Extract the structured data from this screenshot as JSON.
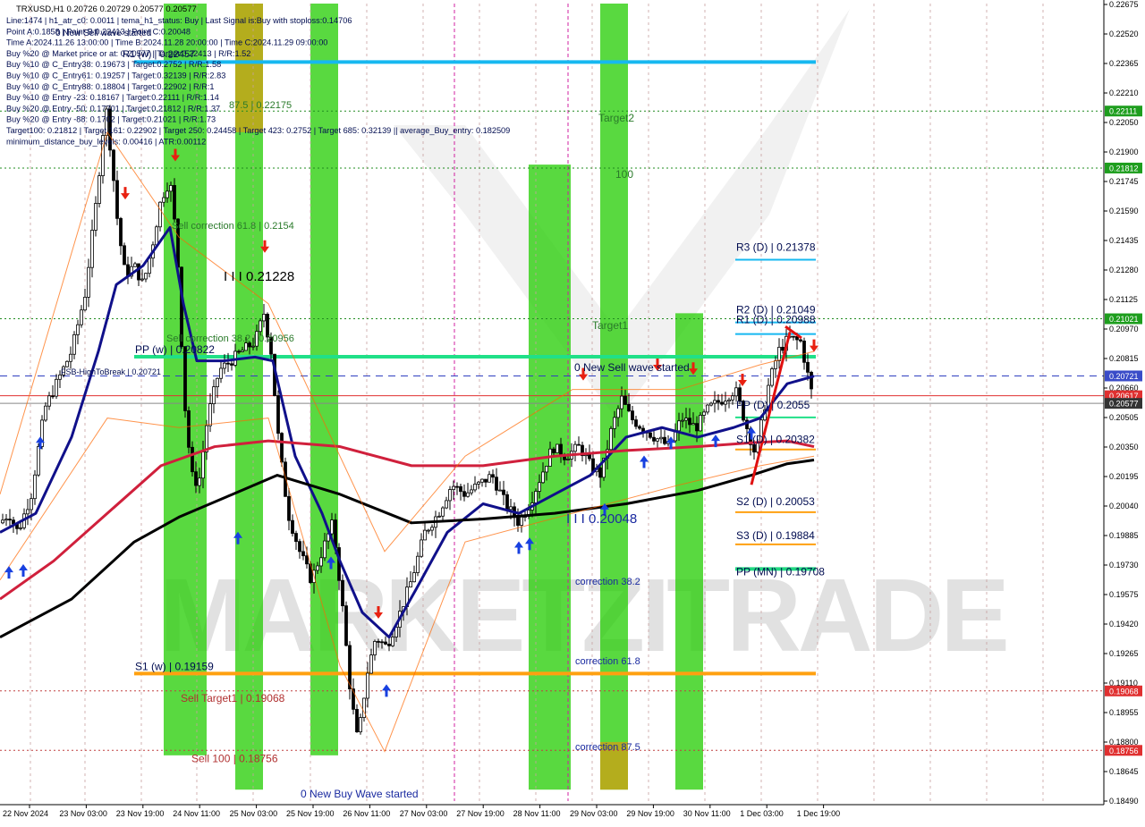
{
  "symbol_header": "TRXUSD,H1  0.20726 0.20729 0.20577 0.20577",
  "info_lines": [
    "Line:1474 | h1_atr_c0: 0.0011 | tema_h1_status: Buy | Last Signal is:Buy with stoploss:0.14706",
    "Point A:0.1858 | Point B:0.22413 | Point C:0.20048",
    "Time A:2024.11.26 13:00:00 | Time B:2024.11.28 20:00:00 | Time C:2024.11.29 09:00:00",
    "Buy %20 @ Market price or at: 0.20577 | Target:0.22413 | R/R:1.52",
    "Buy %10 @ C_Entry38: 0.19673 | Target:0.2752 | R/R:1.58",
    "Buy %10 @ C_Entry61: 0.19257 | Target:0.32139 | R/R:2.83",
    "Buy %10 @ C_Entry88: 0.18804 | Target:0.22902 | R/R:1",
    "Buy %10 @ Entry -23: 0.18167 | Target:0.22111 | R/R:1.14",
    "Buy %20 @ Entry -50: 0.17701 | Target:0.21812 | R/R:1.37",
    "Buy %20 @ Entry -88: 0.1702 | Target:0.21021 | R/R:1.73",
    "Target100: 0.21812 | Target 161: 0.22902 | Target 250: 0.24458 | Target 423: 0.2752 | Target 685: 0.32139 || average_Buy_entry: 0.182509",
    "minimum_distance_buy_levels: 0.00416 | ATR:0.00112"
  ],
  "watermark": "MARKETZITRADE",
  "price_axis": {
    "min": 0.1849,
    "max": 0.22675,
    "ticks": [
      "0.22675",
      "0.22520",
      "0.22365",
      "0.22210",
      "0.22050",
      "0.21900",
      "0.21745",
      "0.21590",
      "0.21435",
      "0.21280",
      "0.21125",
      "0.20970",
      "0.20815",
      "0.20660",
      "0.20505",
      "0.20350",
      "0.20195",
      "0.20040",
      "0.19885",
      "0.19730",
      "0.19575",
      "0.19420",
      "0.19265",
      "0.19110",
      "0.18955",
      "0.18800",
      "0.18645",
      "0.18490"
    ]
  },
  "time_axis": {
    "labels": [
      "22 Nov 2024",
      "23 Nov 03:00",
      "23 Nov 19:00",
      "24 Nov 11:00",
      "25 Nov 03:00",
      "25 Nov 19:00",
      "26 Nov 11:00",
      "27 Nov 03:00",
      "27 Nov 19:00",
      "28 Nov 11:00",
      "29 Nov 03:00",
      "29 Nov 19:00",
      "30 Nov 11:00",
      "1 Dec 03:00",
      "1 Dec 19:00"
    ]
  },
  "price_tags": [
    {
      "text": "0.22111",
      "price": 0.22111,
      "color": "#1e9e1e"
    },
    {
      "text": "0.21812",
      "price": 0.21812,
      "color": "#1e9e1e"
    },
    {
      "text": "0.21021",
      "price": 0.21021,
      "color": "#1e9e1e"
    },
    {
      "text": "0.20721",
      "price": 0.20721,
      "color": "#3a4cc8"
    },
    {
      "text": "0.20617",
      "price": 0.20617,
      "color": "#e03030"
    },
    {
      "text": "0.20577",
      "price": 0.20577,
      "color": "#333333"
    },
    {
      "text": "0.19068",
      "price": 0.19068,
      "color": "#e03030"
    },
    {
      "text": "0.18756",
      "price": 0.18756,
      "color": "#e03030"
    }
  ],
  "level_labels": {
    "r3_d": "R3 (D) | 0.21378",
    "r2_d": "R2 (D) | 0.21049",
    "r1_d": "R1 (D) | 0.20988",
    "pp_d": "PP (D) | 0.2055",
    "s1_d": "S1 (D) | 0.20382",
    "s2_d": "S2 (D) | 0.20053",
    "s3_d": "S3 (D) | 0.19884",
    "pp_mn": "PP (MN) | 0.19708",
    "pp_w": "PP (w) | 0.20822",
    "s1_w": "S1 (w) | 0.19159",
    "r1_w": "R1 (w) | 0.22457",
    "sell_target1": "Sell Target1 | 0.19068",
    "sell_100": "Sell 100 | 0.18756",
    "sell_corr_618": "Sell correction 61.8 | 0.2154",
    "sell_corr_382": "Sell correction 38.2 | 0.20956",
    "sell_corr_875": "87.5 | 0.22175",
    "peak_label": "I I I 0.21228",
    "point_c_label": "I I I 0.20048",
    "fsb": "FSB-HighToBreak | 0.20721",
    "new_sell_top": "0 New Sell wave started",
    "new_sell_mid": "0 New Sell wave started",
    "new_buy": "0 New Buy Wave started",
    "target2": "Target2",
    "target1": "Target1",
    "hundred": "100",
    "corr_382": "correction 38.2",
    "corr_618": "correction 61.8",
    "corr_875": "correction 87.5"
  },
  "chart_data": {
    "type": "candlestick",
    "title": "TRXUSD,H1",
    "ylim": [
      0.1849,
      0.22675
    ],
    "grid": true,
    "close_path": [
      {
        "x": 0,
        "y": 0.1995
      },
      {
        "x": 10,
        "y": 0.2
      },
      {
        "x": 20,
        "y": 0.199
      },
      {
        "x": 35,
        "y": 0.201
      },
      {
        "x": 50,
        "y": 0.2055
      },
      {
        "x": 65,
        "y": 0.207
      },
      {
        "x": 80,
        "y": 0.2085
      },
      {
        "x": 95,
        "y": 0.2115
      },
      {
        "x": 108,
        "y": 0.2165
      },
      {
        "x": 118,
        "y": 0.2215
      },
      {
        "x": 125,
        "y": 0.2185
      },
      {
        "x": 132,
        "y": 0.215
      },
      {
        "x": 140,
        "y": 0.2125
      },
      {
        "x": 150,
        "y": 0.213
      },
      {
        "x": 160,
        "y": 0.212
      },
      {
        "x": 170,
        "y": 0.214
      },
      {
        "x": 180,
        "y": 0.2165
      },
      {
        "x": 190,
        "y": 0.2175
      },
      {
        "x": 198,
        "y": 0.214
      },
      {
        "x": 206,
        "y": 0.206
      },
      {
        "x": 214,
        "y": 0.202
      },
      {
        "x": 222,
        "y": 0.2015
      },
      {
        "x": 232,
        "y": 0.205
      },
      {
        "x": 245,
        "y": 0.2075
      },
      {
        "x": 258,
        "y": 0.208
      },
      {
        "x": 270,
        "y": 0.2085
      },
      {
        "x": 285,
        "y": 0.209
      },
      {
        "x": 295,
        "y": 0.2105
      },
      {
        "x": 303,
        "y": 0.2085
      },
      {
        "x": 312,
        "y": 0.2035
      },
      {
        "x": 322,
        "y": 0.2
      },
      {
        "x": 335,
        "y": 0.198
      },
      {
        "x": 348,
        "y": 0.1965
      },
      {
        "x": 360,
        "y": 0.198
      },
      {
        "x": 372,
        "y": 0.1995
      },
      {
        "x": 382,
        "y": 0.1955
      },
      {
        "x": 392,
        "y": 0.1905
      },
      {
        "x": 400,
        "y": 0.188
      },
      {
        "x": 410,
        "y": 0.1915
      },
      {
        "x": 420,
        "y": 0.1935
      },
      {
        "x": 432,
        "y": 0.193
      },
      {
        "x": 445,
        "y": 0.1945
      },
      {
        "x": 460,
        "y": 0.1965
      },
      {
        "x": 475,
        "y": 0.199
      },
      {
        "x": 490,
        "y": 0.2
      },
      {
        "x": 505,
        "y": 0.2015
      },
      {
        "x": 520,
        "y": 0.201
      },
      {
        "x": 535,
        "y": 0.2015
      },
      {
        "x": 550,
        "y": 0.202
      },
      {
        "x": 565,
        "y": 0.2005
      },
      {
        "x": 580,
        "y": 0.1995
      },
      {
        "x": 592,
        "y": 0.2005
      },
      {
        "x": 605,
        "y": 0.202
      },
      {
        "x": 618,
        "y": 0.2035
      },
      {
        "x": 632,
        "y": 0.203
      },
      {
        "x": 648,
        "y": 0.2035
      },
      {
        "x": 660,
        "y": 0.2025
      },
      {
        "x": 672,
        "y": 0.202
      },
      {
        "x": 684,
        "y": 0.2045
      },
      {
        "x": 695,
        "y": 0.206
      },
      {
        "x": 705,
        "y": 0.205
      },
      {
        "x": 718,
        "y": 0.2045
      },
      {
        "x": 732,
        "y": 0.204
      },
      {
        "x": 748,
        "y": 0.2035
      },
      {
        "x": 762,
        "y": 0.205
      },
      {
        "x": 778,
        "y": 0.2045
      },
      {
        "x": 792,
        "y": 0.2055
      },
      {
        "x": 808,
        "y": 0.206
      },
      {
        "x": 822,
        "y": 0.2065
      },
      {
        "x": 835,
        "y": 0.2045
      },
      {
        "x": 845,
        "y": 0.203
      },
      {
        "x": 858,
        "y": 0.2065
      },
      {
        "x": 870,
        "y": 0.2085
      },
      {
        "x": 882,
        "y": 0.2092
      },
      {
        "x": 895,
        "y": 0.209
      },
      {
        "x": 910,
        "y": 0.20577
      }
    ],
    "series": [
      {
        "name": "tema",
        "color": "#10108a",
        "points": [
          {
            "x": 0,
            "y": 0.199
          },
          {
            "x": 40,
            "y": 0.2
          },
          {
            "x": 80,
            "y": 0.204
          },
          {
            "x": 110,
            "y": 0.2085
          },
          {
            "x": 130,
            "y": 0.212
          },
          {
            "x": 160,
            "y": 0.213
          },
          {
            "x": 190,
            "y": 0.215
          },
          {
            "x": 205,
            "y": 0.211
          },
          {
            "x": 220,
            "y": 0.208
          },
          {
            "x": 250,
            "y": 0.208
          },
          {
            "x": 285,
            "y": 0.2082
          },
          {
            "x": 305,
            "y": 0.208
          },
          {
            "x": 330,
            "y": 0.203
          },
          {
            "x": 360,
            "y": 0.2
          },
          {
            "x": 380,
            "y": 0.1975
          },
          {
            "x": 405,
            "y": 0.1948
          },
          {
            "x": 435,
            "y": 0.1935
          },
          {
            "x": 465,
            "y": 0.196
          },
          {
            "x": 500,
            "y": 0.199
          },
          {
            "x": 540,
            "y": 0.2005
          },
          {
            "x": 580,
            "y": 0.2
          },
          {
            "x": 620,
            "y": 0.201
          },
          {
            "x": 660,
            "y": 0.202
          },
          {
            "x": 700,
            "y": 0.204
          },
          {
            "x": 740,
            "y": 0.2045
          },
          {
            "x": 780,
            "y": 0.204
          },
          {
            "x": 820,
            "y": 0.2045
          },
          {
            "x": 850,
            "y": 0.205
          },
          {
            "x": 880,
            "y": 0.2068
          },
          {
            "x": 910,
            "y": 0.2072
          }
        ]
      },
      {
        "name": "ma-red",
        "color": "#d0203c",
        "points": [
          {
            "x": 0,
            "y": 0.1955
          },
          {
            "x": 60,
            "y": 0.1975
          },
          {
            "x": 120,
            "y": 0.2
          },
          {
            "x": 180,
            "y": 0.2025
          },
          {
            "x": 240,
            "y": 0.2035
          },
          {
            "x": 300,
            "y": 0.2038
          },
          {
            "x": 380,
            "y": 0.2035
          },
          {
            "x": 460,
            "y": 0.2025
          },
          {
            "x": 540,
            "y": 0.2025
          },
          {
            "x": 620,
            "y": 0.203
          },
          {
            "x": 700,
            "y": 0.2033
          },
          {
            "x": 780,
            "y": 0.2035
          },
          {
            "x": 840,
            "y": 0.2037
          },
          {
            "x": 880,
            "y": 0.2038
          },
          {
            "x": 910,
            "y": 0.2035
          }
        ]
      },
      {
        "name": "ma-black",
        "color": "#000000",
        "points": [
          {
            "x": 0,
            "y": 0.1935
          },
          {
            "x": 80,
            "y": 0.1955
          },
          {
            "x": 150,
            "y": 0.1985
          },
          {
            "x": 200,
            "y": 0.1998
          },
          {
            "x": 260,
            "y": 0.201
          },
          {
            "x": 310,
            "y": 0.202
          },
          {
            "x": 380,
            "y": 0.201
          },
          {
            "x": 460,
            "y": 0.1995
          },
          {
            "x": 540,
            "y": 0.1997
          },
          {
            "x": 620,
            "y": 0.2
          },
          {
            "x": 700,
            "y": 0.2005
          },
          {
            "x": 780,
            "y": 0.2012
          },
          {
            "x": 840,
            "y": 0.202
          },
          {
            "x": 880,
            "y": 0.2026
          },
          {
            "x": 910,
            "y": 0.2028
          }
        ]
      }
    ],
    "levels": [
      {
        "name": "R1 (w)",
        "price": 0.22368,
        "color": "#16b8f0",
        "style": "solid"
      },
      {
        "name": "PP (w)",
        "price": 0.20822,
        "color": "#20e088",
        "style": "solid"
      },
      {
        "name": "S1 (w)",
        "price": 0.19159,
        "color": "#ffa010",
        "style": "solid"
      },
      {
        "name": "PP (MN)",
        "price": 0.19708,
        "color": "#20d880",
        "style": "solid"
      },
      {
        "name": "Target 0.22111",
        "price": 0.22111,
        "color": "#208c20",
        "style": "dotted"
      },
      {
        "name": "Target 0.21812",
        "price": 0.21812,
        "color": "#208c20",
        "style": "dotted"
      },
      {
        "name": "Target 0.21021",
        "price": 0.21021,
        "color": "#208c20",
        "style": "dotted"
      },
      {
        "name": "FSB-HighToBreak",
        "price": 0.20721,
        "color": "#3040c0",
        "style": "dashed"
      },
      {
        "name": "0.20617",
        "price": 0.20617,
        "color": "#e03030",
        "style": "solid"
      },
      {
        "name": "Close",
        "price": 0.20577,
        "color": "#888888",
        "style": "solid"
      },
      {
        "name": "Sell Target1",
        "price": 0.19068,
        "color": "#c04040",
        "style": "dotted"
      },
      {
        "name": "Sell 100",
        "price": 0.18756,
        "color": "#c04040",
        "style": "dotted"
      }
    ],
    "daily_levels": [
      {
        "name": "R3 (D)",
        "price": 0.21378,
        "color": "#16b8f0"
      },
      {
        "name": "R2 (D)",
        "price": 0.21049,
        "color": "#16b8f0"
      },
      {
        "name": "R1 (D)",
        "price": 0.20988,
        "color": "#16b8f0"
      },
      {
        "name": "PP (D)",
        "price": 0.2055,
        "color": "#20e088"
      },
      {
        "name": "S1 (D)",
        "price": 0.20382,
        "color": "#ffa010"
      },
      {
        "name": "S2 (D)",
        "price": 0.20053,
        "color": "#ffa010"
      },
      {
        "name": "S3 (D)",
        "price": 0.19884,
        "color": "#ffa010"
      }
    ],
    "zones": [
      {
        "color": "#22cc00",
        "top": 0.22675,
        "bottom": 0.1873
      },
      {
        "color": "#22cc00",
        "top": 0.22675,
        "bottom": 0.1855
      },
      {
        "color": "#ff8800",
        "top": 0.22675,
        "bottom": 0.22
      },
      {
        "color": "#22cc00",
        "top": 0.22675,
        "bottom": 0.1873
      },
      {
        "color": "#22cc00",
        "top": 0.2183,
        "bottom": 0.1855
      },
      {
        "color": "#22cc00",
        "top": 0.22675,
        "bottom": 0.1855
      },
      {
        "color": "#ff8800",
        "top": 0.188,
        "bottom": 0.1855
      },
      {
        "color": "#22cc00",
        "top": 0.2105,
        "bottom": 0.1855
      }
    ],
    "buy_arrows": [
      0.1977,
      0.1978,
      0.2045,
      0.1995,
      0.1982,
      0.1915,
      0.199,
      0.1992,
      0.201,
      0.2035,
      0.2045,
      0.2046,
      0.205
    ],
    "sell_arrows": [
      0.216,
      0.218,
      0.2132,
      0.194,
      0.2065,
      0.207,
      0.2068,
      0.2062,
      0.208
    ]
  }
}
